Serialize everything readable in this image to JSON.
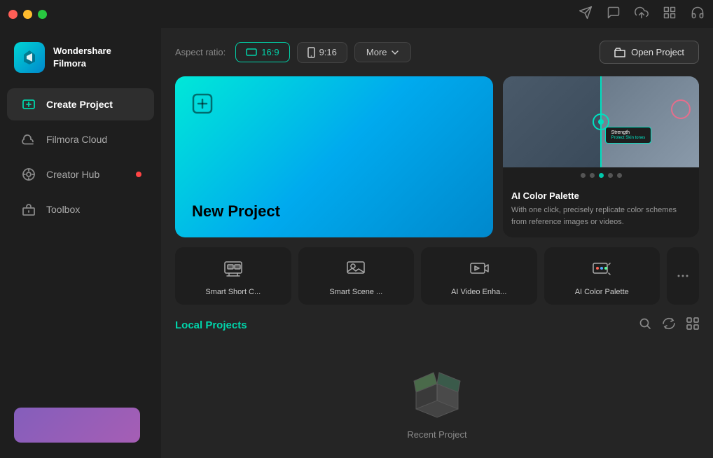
{
  "titlebar": {
    "traffic_lights": [
      "red",
      "yellow",
      "green"
    ],
    "icons": [
      "send",
      "chat",
      "upload",
      "grid",
      "headphone"
    ]
  },
  "sidebar": {
    "logo": {
      "name": "Wondershare\nFilmora"
    },
    "nav_items": [
      {
        "id": "create-project",
        "label": "Create Project",
        "active": true,
        "dot": false
      },
      {
        "id": "filmora-cloud",
        "label": "Filmora Cloud",
        "active": false,
        "dot": false
      },
      {
        "id": "creator-hub",
        "label": "Creator Hub",
        "active": false,
        "dot": true
      },
      {
        "id": "toolbox",
        "label": "Toolbox",
        "active": false,
        "dot": false
      }
    ]
  },
  "topbar": {
    "aspect_ratio_label": "Aspect ratio:",
    "aspect_16_9": "16:9",
    "aspect_9_16": "9:16",
    "more_label": "More",
    "open_project_label": "Open Project"
  },
  "new_project": {
    "title": "New Project"
  },
  "feature_card": {
    "title": "AI Color Palette",
    "description": "With one click, precisely replicate color schemes from reference images or videos.",
    "dots": [
      false,
      false,
      true,
      false,
      false
    ]
  },
  "ai_tools": [
    {
      "id": "smart-short-clips",
      "label": "Smart Short C...",
      "icon": "smart-short"
    },
    {
      "id": "smart-scene",
      "label": "Smart Scene ...",
      "icon": "smart-scene"
    },
    {
      "id": "ai-video-enhance",
      "label": "AI Video Enha...",
      "icon": "ai-enhance"
    },
    {
      "id": "ai-color-palette",
      "label": "AI Color Palette",
      "icon": "ai-color"
    }
  ],
  "local_projects": {
    "title": "Local Projects",
    "empty_label": "Recent Project"
  }
}
